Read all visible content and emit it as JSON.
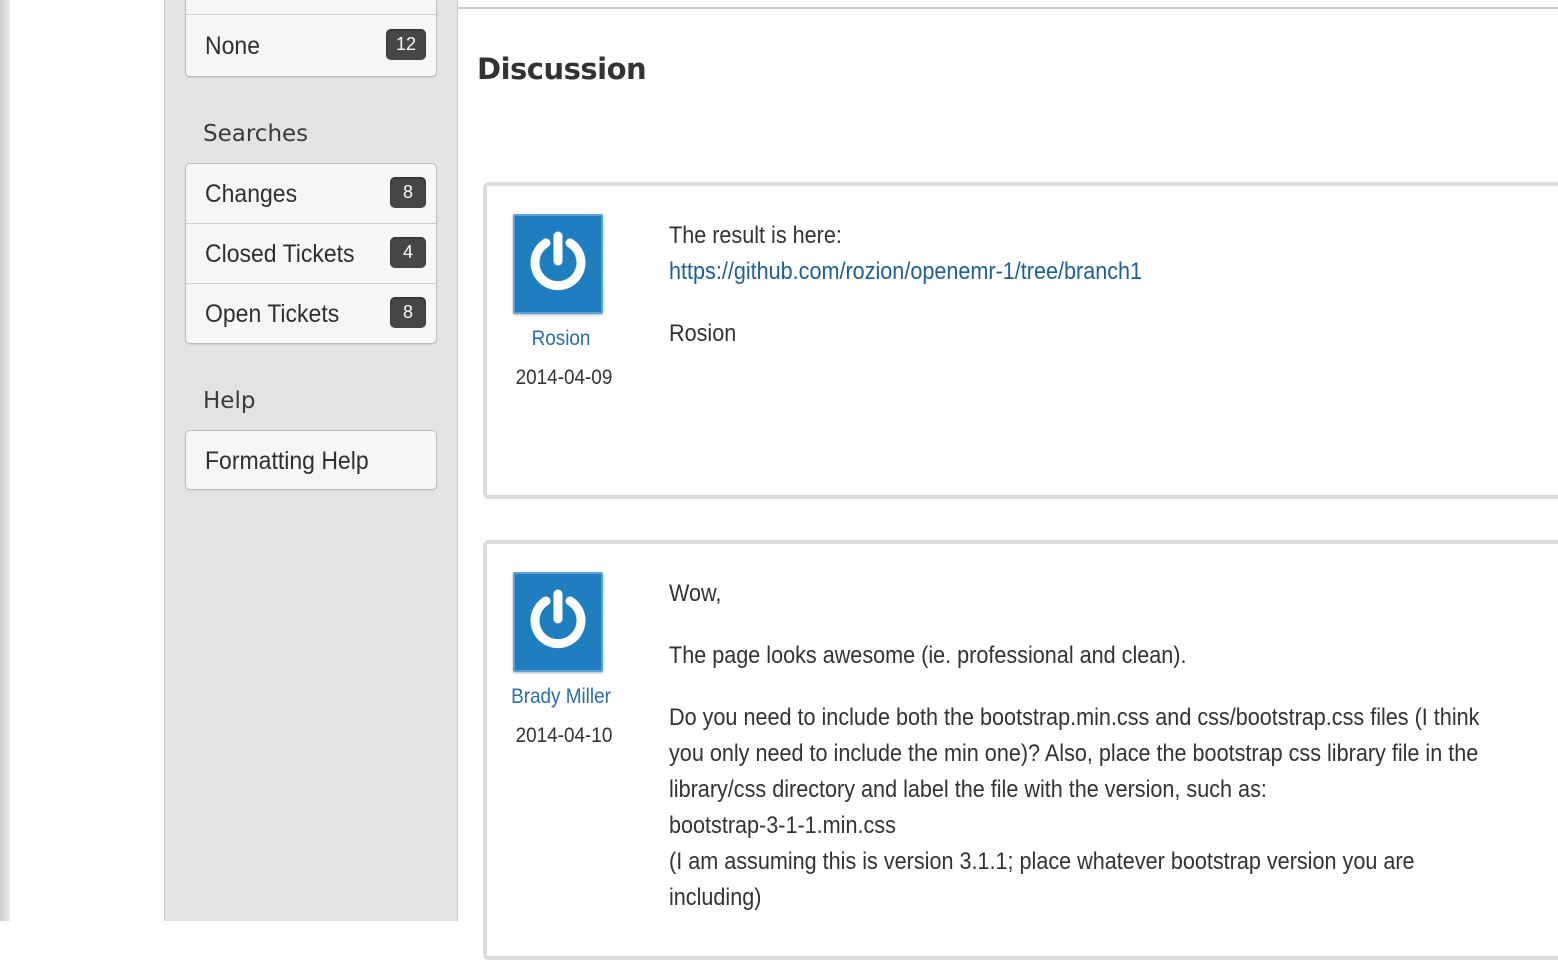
{
  "sidebar": {
    "top_item": {
      "label": "None",
      "count": "12"
    },
    "searches_heading": "Searches",
    "searches": [
      {
        "label": "Changes",
        "count": "8"
      },
      {
        "label": "Closed Tickets",
        "count": "4"
      },
      {
        "label": "Open Tickets",
        "count": "8"
      }
    ],
    "help_heading": "Help",
    "help_items": [
      {
        "label": "Formatting Help"
      }
    ]
  },
  "main": {
    "title": "Discussion",
    "posts": [
      {
        "author": "Rosion",
        "date": "2014-04-09",
        "lines": [
          "The result is here:"
        ],
        "link": "https://github.com/rozion/openemr-1/tree/branch1",
        "signature": "Rosion"
      },
      {
        "author": "Brady Miller",
        "date": "2014-04-10",
        "p1": "Wow,",
        "p2": "The page looks awesome (ie. professional and clean).",
        "p3_lines": [
          "Do you need to include both the bootstrap.min.css and css/bootstrap.css files (I think",
          "you only need to include the min one)? Also, place the bootstrap css library file in the",
          "library/css directory and label the file with the version, such as:",
          "bootstrap-3-1-1.min.css",
          "(I am assuming this is version 3.1.1; place whatever bootstrap version you are",
          "including)"
        ]
      }
    ]
  },
  "colors": {
    "sidebar_bg": "#e3e3e3",
    "badge_bg": "#474747",
    "avatar_blue": "#1f7ec0",
    "link": "#1e5f95"
  },
  "icons": {
    "avatar": "power-icon"
  }
}
